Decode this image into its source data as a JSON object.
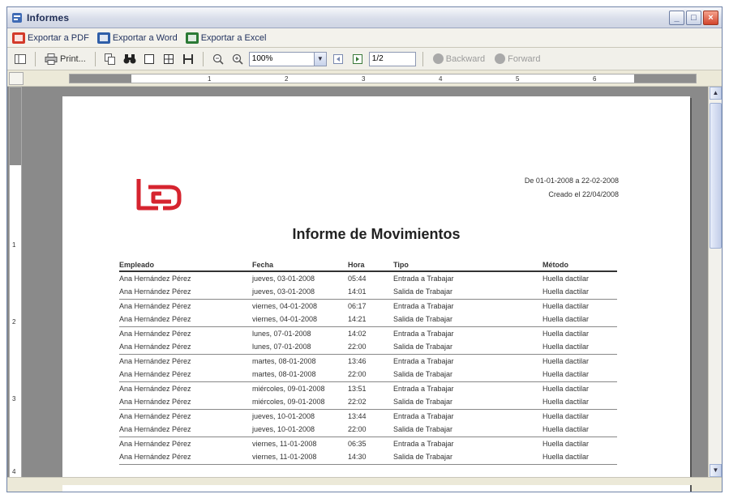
{
  "window": {
    "title": "Informes",
    "controls": [
      "minimize",
      "maximize",
      "close"
    ]
  },
  "export_bar": {
    "items": [
      {
        "label": "Exportar a PDF",
        "icon": "pdf-icon"
      },
      {
        "label": "Exportar a Word",
        "icon": "word-icon"
      },
      {
        "label": "Exportar a Excel",
        "icon": "excel-icon"
      }
    ]
  },
  "toolbar": {
    "print_label": "Print...",
    "zoom_value": "100%",
    "page_value": "1/2",
    "back_label": "Backward",
    "forward_label": "Forward"
  },
  "ruler": {
    "labels": [
      "1",
      "2",
      "3",
      "4",
      "5",
      "6"
    ],
    "vertical_labels": [
      "1",
      "2",
      "3",
      "4"
    ]
  },
  "report": {
    "date_range": "De 01-01-2008 a 22-02-2008",
    "created": "Creado el 22/04/2008",
    "title": "Informe de Movimientos",
    "columns": [
      "Empleado",
      "Fecha",
      "Hora",
      "Tipo",
      "Método"
    ],
    "rows": [
      [
        "Ana Hernández Pérez",
        "jueves, 03-01-2008",
        "05:44",
        "Entrada a Trabajar",
        "Huella dactilar"
      ],
      [
        "Ana Hernández Pérez",
        "jueves, 03-01-2008",
        "14:01",
        "Salida de Trabajar",
        "Huella dactilar"
      ],
      [
        "Ana Hernández Pérez",
        "viernes, 04-01-2008",
        "06:17",
        "Entrada a Trabajar",
        "Huella dactilar"
      ],
      [
        "Ana Hernández Pérez",
        "viernes, 04-01-2008",
        "14:21",
        "Salida de Trabajar",
        "Huella dactilar"
      ],
      [
        "Ana Hernández Pérez",
        "lunes, 07-01-2008",
        "14:02",
        "Entrada a Trabajar",
        "Huella dactilar"
      ],
      [
        "Ana Hernández Pérez",
        "lunes, 07-01-2008",
        "22:00",
        "Salida de Trabajar",
        "Huella dactilar"
      ],
      [
        "Ana Hernández Pérez",
        "martes, 08-01-2008",
        "13:46",
        "Entrada a Trabajar",
        "Huella dactilar"
      ],
      [
        "Ana Hernández Pérez",
        "martes, 08-01-2008",
        "22:00",
        "Salida de Trabajar",
        "Huella dactilar"
      ],
      [
        "Ana Hernández Pérez",
        "miércoles, 09-01-2008",
        "13:51",
        "Entrada a Trabajar",
        "Huella dactilar"
      ],
      [
        "Ana Hernández Pérez",
        "miércoles, 09-01-2008",
        "22:02",
        "Salida de Trabajar",
        "Huella dactilar"
      ],
      [
        "Ana Hernández Pérez",
        "jueves, 10-01-2008",
        "13:44",
        "Entrada a Trabajar",
        "Huella dactilar"
      ],
      [
        "Ana Hernández Pérez",
        "jueves, 10-01-2008",
        "22:00",
        "Salida de Trabajar",
        "Huella dactilar"
      ],
      [
        "Ana Hernández Pérez",
        "viernes, 11-01-2008",
        "06:35",
        "Entrada a Trabajar",
        "Huella dactilar"
      ],
      [
        "Ana Hernández Pérez",
        "viernes, 11-01-2008",
        "14:30",
        "Salida de Trabajar",
        "Huella dactilar"
      ]
    ]
  },
  "colors": {
    "logo": "#d6242f",
    "page_background": "#8a8a8a",
    "window_frame": "#6f83a8"
  }
}
